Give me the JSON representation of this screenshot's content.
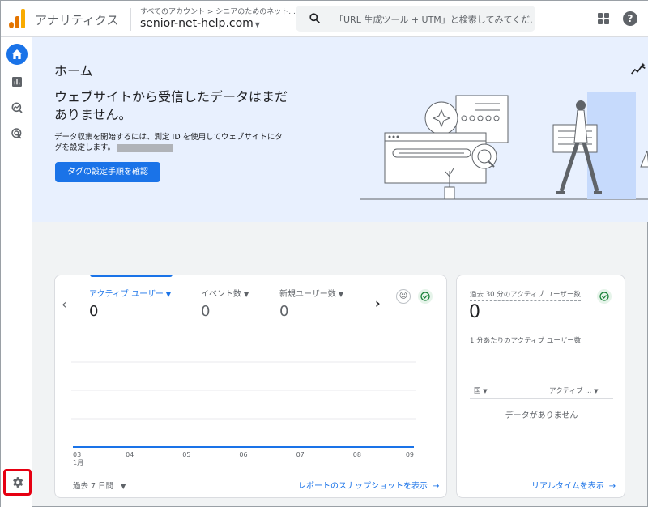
{
  "header": {
    "app_name": "アナリティクス",
    "breadcrumb": "すべてのアカウント > シニアのためのネット...",
    "property": "senior-net-help.com",
    "property_caret": "▼",
    "search_placeholder": "「URL 生成ツール + UTM」と検索してみてくだ...",
    "help_glyph": "?",
    "logo_colors": [
      "#f9ab00",
      "#e37400",
      "#e37400"
    ]
  },
  "nav": {
    "items": [
      "home-icon",
      "reports-icon",
      "explore-icon",
      "advertising-icon"
    ],
    "settings": "gear-icon",
    "accent": "#1a73e8",
    "highlight": "#e60012"
  },
  "hero": {
    "title": "ホーム",
    "heading": "ウェブサイトから受信したデータはまだありません。",
    "description": "データ収集を開始するには、測定 ID を使用してウェブサイトにタグを設定します。",
    "button": "タグの設定手順を確認"
  },
  "snapshot": {
    "metrics": [
      {
        "label": "アクティブ ユーザー",
        "value": "0"
      },
      {
        "label": "イベント数",
        "value": "0"
      },
      {
        "label": "新規ユーザー数",
        "value": "0"
      }
    ],
    "caret": "▼",
    "prev": "‹",
    "next": "›",
    "x_ticks": [
      "03",
      "04",
      "05",
      "06",
      "07",
      "08",
      "09"
    ],
    "month_label": "1月",
    "date_range": "過去 7 日間",
    "date_caret": "▼",
    "report_link": "レポートのスナップショットを表示",
    "arrow": "→"
  },
  "chart_data": {
    "type": "line",
    "x": [
      "03",
      "04",
      "05",
      "06",
      "07",
      "08",
      "09"
    ],
    "series": [
      {
        "values": [
          0,
          0,
          0,
          0,
          0,
          0,
          0
        ]
      }
    ],
    "grid": true
  },
  "realtime": {
    "title": "過去 30 分のアクティブ ユーザー数",
    "value": "0",
    "subtitle": "1 分あたりのアクティブ ユーザー数",
    "col_country": "国",
    "col_users": "アクティブ ...",
    "col_caret": "▼",
    "empty": "データがありません",
    "link": "リアルタイムを表示",
    "arrow": "→"
  }
}
